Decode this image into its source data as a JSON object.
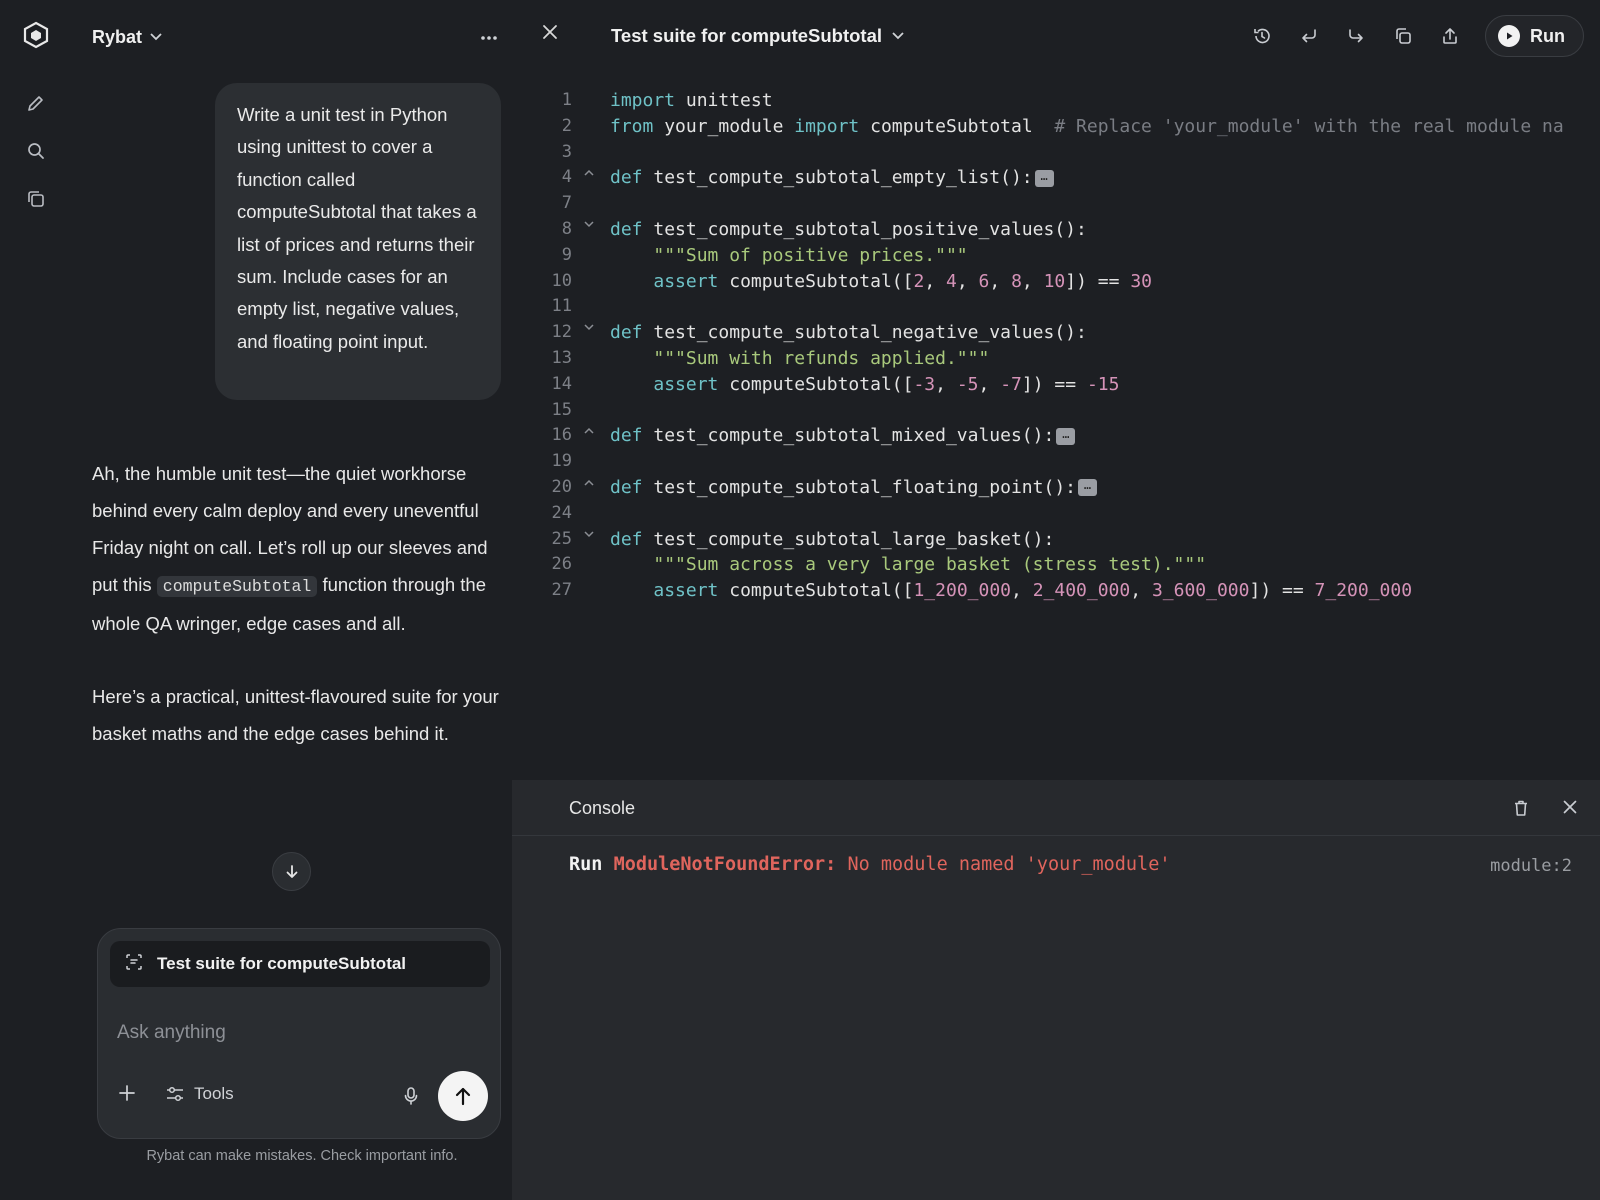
{
  "app": {
    "name": "Rybat"
  },
  "chat": {
    "user_message": "Write a unit test in Python using unittest to cover a function called computeSubtotal that takes a list of prices and returns their sum. Include cases for an empty list, negative values, and floating point input.",
    "assistant": {
      "p1_before": "Ah, the humble unit test—the quiet workhorse behind every calm deploy and every uneventful Friday night on call. Let’s roll up our sleeves and put this ",
      "p1_code": "computeSubtotal",
      "p1_after": " function through the whole QA wringer, edge cases and all.",
      "p2": "Here’s a practical, unittest-flavoured suite for your basket maths and the edge cases behind it."
    },
    "composer": {
      "attachment_label": "Test suite for computeSubtotal",
      "placeholder": "Ask anything",
      "tools_label": "Tools"
    },
    "disclaimer": "Rybat can make mistakes. Check important info."
  },
  "editor": {
    "title": "Test suite for computeSubtotal",
    "run_label": "Run",
    "lines": [
      {
        "n": "1",
        "fold": "",
        "tokens": [
          [
            "kw",
            "import"
          ],
          [
            "t",
            " unittest"
          ]
        ]
      },
      {
        "n": "2",
        "fold": "",
        "tokens": [
          [
            "kw",
            "from"
          ],
          [
            "t",
            " your_module "
          ],
          [
            "kw",
            "import"
          ],
          [
            "t",
            " computeSubtotal  "
          ],
          [
            "cm",
            "# Replace 'your_module' with the real module na"
          ]
        ]
      },
      {
        "n": "3",
        "fold": "",
        "tokens": []
      },
      {
        "n": "4",
        "fold": "^",
        "tokens": [
          [
            "kw",
            "def"
          ],
          [
            "t",
            " test_compute_subtotal_empty_list():"
          ],
          [
            "el",
            "…"
          ]
        ]
      },
      {
        "n": "7",
        "fold": "",
        "tokens": []
      },
      {
        "n": "8",
        "fold": "v",
        "tokens": [
          [
            "kw",
            "def"
          ],
          [
            "t",
            " test_compute_subtotal_positive_values():"
          ]
        ]
      },
      {
        "n": "9",
        "fold": "",
        "tokens": [
          [
            "t",
            "    "
          ],
          [
            "str",
            "\"\"\"Sum of positive prices.\"\"\""
          ]
        ]
      },
      {
        "n": "10",
        "fold": "",
        "tokens": [
          [
            "t",
            "    "
          ],
          [
            "kw",
            "assert"
          ],
          [
            "t",
            " computeSubtotal(["
          ],
          [
            "num",
            "2"
          ],
          [
            "t",
            ", "
          ],
          [
            "num",
            "4"
          ],
          [
            "t",
            ", "
          ],
          [
            "num",
            "6"
          ],
          [
            "t",
            ", "
          ],
          [
            "num",
            "8"
          ],
          [
            "t",
            ", "
          ],
          [
            "num",
            "10"
          ],
          [
            "t",
            "]) == "
          ],
          [
            "num",
            "30"
          ]
        ]
      },
      {
        "n": "11",
        "fold": "",
        "tokens": []
      },
      {
        "n": "12",
        "fold": "v",
        "tokens": [
          [
            "kw",
            "def"
          ],
          [
            "t",
            " test_compute_subtotal_negative_values():"
          ]
        ]
      },
      {
        "n": "13",
        "fold": "",
        "tokens": [
          [
            "t",
            "    "
          ],
          [
            "str",
            "\"\"\"Sum with refunds applied.\"\"\""
          ]
        ]
      },
      {
        "n": "14",
        "fold": "",
        "tokens": [
          [
            "t",
            "    "
          ],
          [
            "kw",
            "assert"
          ],
          [
            "t",
            " computeSubtotal(["
          ],
          [
            "num",
            "-3"
          ],
          [
            "t",
            ", "
          ],
          [
            "num",
            "-5"
          ],
          [
            "t",
            ", "
          ],
          [
            "num",
            "-7"
          ],
          [
            "t",
            "]) == "
          ],
          [
            "num",
            "-15"
          ]
        ]
      },
      {
        "n": "15",
        "fold": "",
        "tokens": []
      },
      {
        "n": "16",
        "fold": "^",
        "tokens": [
          [
            "kw",
            "def"
          ],
          [
            "t",
            " test_compute_subtotal_mixed_values():"
          ],
          [
            "el",
            "…"
          ]
        ]
      },
      {
        "n": "19",
        "fold": "",
        "tokens": []
      },
      {
        "n": "20",
        "fold": "^",
        "tokens": [
          [
            "kw",
            "def"
          ],
          [
            "t",
            " test_compute_subtotal_floating_point():"
          ],
          [
            "el",
            "…"
          ]
        ]
      },
      {
        "n": "24",
        "fold": "",
        "tokens": []
      },
      {
        "n": "25",
        "fold": "v",
        "tokens": [
          [
            "kw",
            "def"
          ],
          [
            "t",
            " test_compute_subtotal_large_basket():"
          ]
        ]
      },
      {
        "n": "26",
        "fold": "",
        "tokens": [
          [
            "t",
            "    "
          ],
          [
            "str",
            "\"\"\"Sum across a very large basket (stress test).\"\"\""
          ]
        ]
      },
      {
        "n": "27",
        "fold": "",
        "tokens": [
          [
            "t",
            "    "
          ],
          [
            "kw",
            "assert"
          ],
          [
            "t",
            " computeSubtotal(["
          ],
          [
            "num",
            "1_200_000"
          ],
          [
            "t",
            ", "
          ],
          [
            "num",
            "2_400_000"
          ],
          [
            "t",
            ", "
          ],
          [
            "num",
            "3_600_000"
          ],
          [
            "t",
            "]) == "
          ],
          [
            "num",
            "7_200_000"
          ]
        ]
      }
    ]
  },
  "console": {
    "title": "Console",
    "run_prefix": "Run",
    "error_type": "ModuleNotFoundError:",
    "error_message": " No module named 'your_module'",
    "location": "module:2"
  },
  "colors": {
    "keyword": "#6fc2c7",
    "string": "#a9c97c",
    "number": "#d593b8",
    "comment": "#7a7d84",
    "error": "#e0655d"
  }
}
